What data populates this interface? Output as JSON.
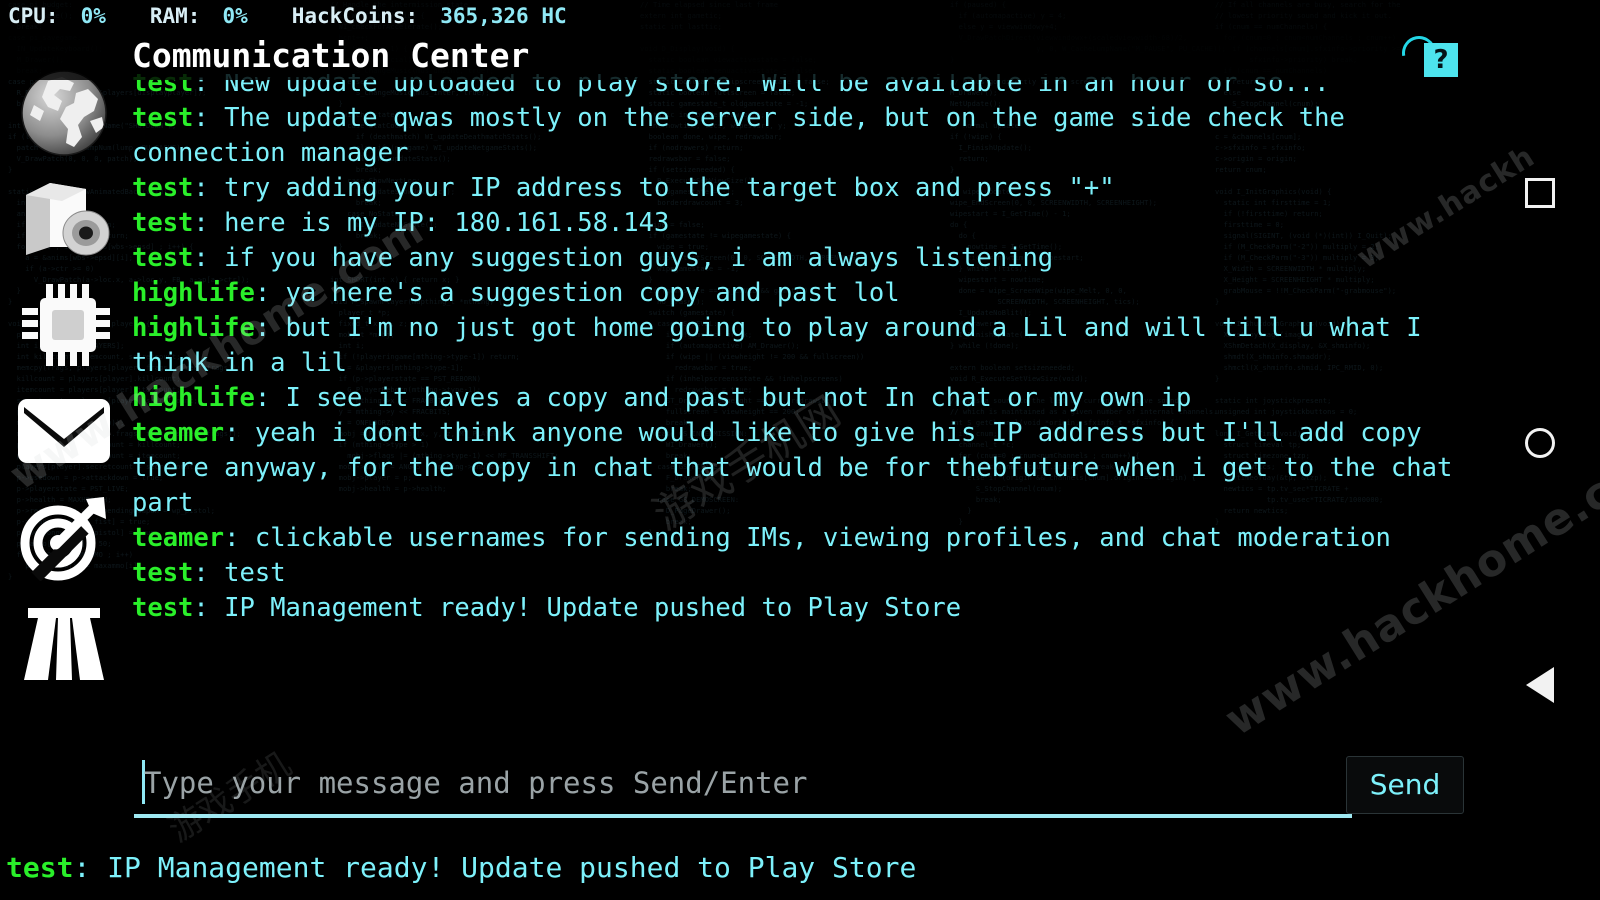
{
  "hud": {
    "cpu_label": "CPU:",
    "cpu_value": "0%",
    "ram_label": "RAM:",
    "ram_value": "0%",
    "coins_label": "HackCoins:",
    "coins_value": "365,326 HC"
  },
  "header": {
    "title": "Communication Center",
    "help_label": "?"
  },
  "sidebar": {
    "items": [
      {
        "name": "globe-icon",
        "label": "World"
      },
      {
        "name": "software-icon",
        "label": "Software"
      },
      {
        "name": "cpu-icon",
        "label": "Hardware"
      },
      {
        "name": "mail-icon",
        "label": "Messages"
      },
      {
        "name": "target-icon",
        "label": "Targets"
      },
      {
        "name": "road-icon",
        "label": "Missions"
      }
    ]
  },
  "chat": {
    "messages": [
      {
        "user": "test",
        "text": "New update uploaded to play store. Will be available in an hour or so..."
      },
      {
        "user": "test",
        "text": "The update qwas mostly on the server side, but on the game side check the connection manager"
      },
      {
        "user": "test",
        "text": "try adding your IP address to the target box and press \"+\""
      },
      {
        "user": "test",
        "text": "here is my IP: 180.161.58.143"
      },
      {
        "user": "test",
        "text": "if you have any suggestion guys, i am always listening"
      },
      {
        "user": "highlife",
        "text": "ya here's a suggestion copy and past lol"
      },
      {
        "user": "highlife",
        "text": "but I'm no just got home going to play around a Lil and will till u what I think in a lil"
      },
      {
        "user": "highlife",
        "text": "I see it haves a copy and past but not In chat or my own ip"
      },
      {
        "user": "teamer",
        "text": "yeah i dont think anyone would like to give his IP address but I'll add copy there anyway, for the copy in chat that would be for thebfuture when i get to the chat part"
      },
      {
        "user": "teamer",
        "text": "clickable usernames for sending IMs, viewing profiles, and chat moderation"
      },
      {
        "user": "test",
        "text": "test"
      },
      {
        "user": "test",
        "text": "IP Management ready! Update pushed to Play Store"
      }
    ]
  },
  "composer": {
    "input_value": "",
    "placeholder": "Type your message and press Send/Enter",
    "send_label": "Send"
  },
  "ticker": {
    "user": "test",
    "separator": ": ",
    "text": "IP Management ready! Update pushed to Play Store"
  },
  "navbar": {
    "recents_label": "recents-square-icon",
    "home_label": "home-circle-icon",
    "back_label": "back-triangle-icon"
  },
  "watermarks": {
    "site": "www.hackhome.com",
    "site_short": "www.hackh",
    "cn": "游戏手机网",
    "cn2": "游戏手机"
  },
  "colors": {
    "accent_cyan": "#7df1fb",
    "username_green": "#2aef2a",
    "help_badge": "#4de4ee",
    "background": "#000000"
  },
  "code_texture": {
    "col1": "case pi_budget:\n  D_DrawGame();\n  break;\ncase pi_savegame:\n  IN_UpdateKeyboard();\n  M_Drawer();\n  break;\ncase pi_loadgame:\n  R_RenderPlayerView(&players[displayplayer]);\n  break;\n\nint lump = W_GetNumForName(\"SHUTDOWN\");\nif (lump != -1) {\n  patch = W_CacheLumpNum(lump, PU_CACHE);\n  V_DrawPatch(0, 0, 0, patch);\n}\n\nstatic void WI_drawAnimatedBack(void) {\n  int i;\n  anim_t *a;\n  if (commercial) return;\n  if (wbs->epsd > 2) return;\n  for (i=0 ; i<NUMANIMS[wbs->epsd] ; i++) {\n    a = &anims[wbs->epsd][i];\n    if (a->ctr >= 0)\n      V_DrawPatch(a->loc.x, a->loc.y, FB, a->p[a->ctr]);\n  }\n}\n\nvoid G_PlayerReborn(int player) {\n  player_t *p;\n  int i, frags[MAXPLAYERS];\n  int killcount, itemcount, secretcount;\n  memcpy(frags, players[player].frags, sizeof(frags));\n  killcount = players[player].killcount;\n  itemcount = players[player].itemcount;\n  secretcount = players[player].secretcount;\n  p = &players[player];\n  memset(p, 0, sizeof(*p));\n  memcpy(players[player].frags, frags, sizeof(frags));\n  players[player].killcount = killcount;\n  players[player].itemcount = itemcount;\n  players[player].secretcount = secretcount;\n  p->usedown = p->attackdown = true;\n  p->playerstate = PST_LIVE;\n  p->health = MAXHEALTH;\n  p->readyweapon = p->pendingweapon = wp_pistol;\n  p->weaponowned[wp_fist] = true;\n  p->weaponowned[wp_pistol] = true;\n  p->ammo[am_clip] = 50;\n  for (i=0 ; i<NUMAMMO ; i++)\n    p->maxammo[i] = maxammo[i];\n}",
    "col2": "// Handle the intermission state\nvoid WI_Ticker(void) {\n  WI_checkForAccelerate();\n  bcnt++;\n  if (bcnt == 1) {\n    if (commercial)\n      S_ChangeMusic(mus_dm2int, true);\n    else\n      S_ChangeMusic(mus_inter, true);\n  }\n  switch (state) {\n    case StatCount:\n      if (deathmatch) WI_updateDeathmatchStats();\n      else if (netgame) WI_updateNetgameStats();\n      else WI_updateStats();\n      break;\n    case ShowNextLoc:\n      WI_updateShowNextLoc();\n      break;\n    case NoState:\n      WI_updateNoState();\n      break;\n  }\n}\n\nint SHORT(int x) { return x; }\n\nvoid P_SpawnPlayer(mapthing_t *mthing) {\n  player_t *p;\n  fixed_t x, y, z;\n  mobj_t *mobj;\n  int i;\n  if (!playeringame[mthing->type-1]) return;\n  p = &players[mthing->type-1];\n  if (p->playerstate == PST_REBORN)\n    G_PlayerReborn(mthing->type-1);\n  x = mthing->x << FRACBITS;\n  y = mthing->y << FRACBITS;\n  z = ONFLOORZ;\n  mobj = P_SpawnMobj(x, y, z, MT_PLAYER);\n  if (mthing->type > 1)\n    mobj->flags |= (mthing->type-1) << MF_TRANSSHIFT;\n  mobj->angle = ANG45 * (mthing->angle/45);\n  mobj->player = p;\n  mobj->health = p->health;",
    "col3": "// Time elapsed since last frame\nextern int gametic;\nstatic int lasttic;\n\nvoid D_Display(void) {\n  static boolean viewactivestate = false;\n  static boolean menuactivestate = false;\n  static boolean inhelpscreensstate = false;\n  static boolean fullscreen = false;\n  static gamestate_t oldgamestate = -1;\n  static int borderdrawcount;\n  int nowtime, tics, wipestart, y;\n  boolean done, wipe, redrawsbar;\n  if (nodrawers) return;\n  redrawsbar = false;\n  if (setsizeneeded) {\n    R_ExecuteSetViewSize();\n    oldgamestate = -1;\n    borderdrawcount = 3;\n  }\n  wipe = false;\n  if (gamestate != wipegamestate) {\n    wipe = true;\n    wipe_StartScreen(0, 0, SCREENWIDTH, SCREENHEIGHT);\n    wipegamestate = -1;\n  }\n  if (gamestate == GS_LEVEL && gametic)\n    HU_Erase();\n  switch (gamestate) {\n    case GS_LEVEL:\n      if (!gametic) break;\n      if (automapactive) AM_Drawer();\n      if (wipe || (viewheight != 200 && fullscreen))\n        redrawsbar = true;\n      if (inhelpscreensstate && !inhelpscreens)\n        redrawsbar = true;\n      ST_Drawer(viewheight == 200, redrawsbar);\n      fullscreen = viewheight == 200;\n      break;\n    case GS_INTERMISSION:\n      WI_Drawer();\n      break;\n    case GS_FINALE:\n      F_Drawer();\n      break;\n    case GS_DEMOSCREEN:\n      D_PageDrawer();\n      break;\n  }",
    "col4": "if (paused) {\n  if (automapactive) y = 4;\n  else y = viewwindowy+4;\n  V_DrawPatchDirect(viewwindowx+(scaledviewwidth-68)/2,\n                    y, 0, W_CacheLumpName(\"M_PAUSE\", PU_CACHE));\n}\n\n// menus go directly to the screen\nM_Drawer();\nNetUpdate();\n\n// normal update\nif (!wipe) {\n  I_FinishUpdate();\n  return;\n}\n\n// wipe update\nwipe_EndScreen(0, 0, SCREENWIDTH, SCREENHEIGHT);\nwipestart = I_GetTime() - 1;\ndo {\n  do {\n    nowtime = I_GetTime();\n    tics = nowtime - wipestart;\n  } while (!tics);\n  wipestart = nowtime;\n  done = wipe_ScreenWipe(wipe_Melt, 0, 0,\n           SCREENWIDTH, SCREENHEIGHT, tics);\n  I_UpdateNoBlit();\n  M_Drawer();\n  I_FinishUpdate();\n} while (!done);\n\nextern boolean setsizeneeded;\nvoid R_ExecuteSetViewSize(void);\n\n// Adds a sound to the list of currently active sounds,\n// which is maintained as a given number of internal channels.\nint S_getChannel(void *origin, sfxinfo_t *sfxinfo) {\n  int cnum;\n  channel_t *c;\n  for (cnum=0 ; cnum<numChannels ; cnum++) {\n    if (!channels[cnum].sfxinfo) break;\n    else if (origin && channels[cnum].origin == origin) {\n      S_StopChannel(cnum);\n      break;\n    }\n  }",
    "col5": "// If all channels are busy, search for the\n// lowest priority sound and kick it out.\nif (cnum == numChannels) {\n  for (cnum=0 ; cnum<numChannels ; cnum++)\n    if (channels[cnum].sfxinfo->priority >=\n        sfxinfo->priority) break;\n  if (cnum == numChannels)\n    return -1;\n  else\n    S_StopChannel(cnum);\n}\n\nc = &channels[cnum];\nc->sfxinfo = sfxinfo;\nc->origin = origin;\nreturn cnum;\n\nvoid I_InitGraphics(void) {\n  static int firsttime = 1;\n  if (!firsttime) return;\n  firsttime = 0;\n  signal(SIGINT, (void (*)(int)) I_Quit);\n  if (M_CheckParm(\"-2\")) multiply = 2;\n  if (M_CheckParm(\"-3\")) multiply = 3;\n  X_Width = SCREENWIDTH * multiply;\n  X_Height = SCREENHEIGHT * multiply;\n  grabMouse = !!M_CheckParm(\"-grabmouse\");\n}\n\nvoid I_ShutdownGraphics(void) {\n  XDestroyImage(image);\n  XShmDetach(X_display, &X_shminfo);\n  shmdt(X_shminfo.shmaddr);\n  shmctl(X_shminfo.shmid, IPC_RMID, 0);\n}\n\nstatic int joystickpresent;\nunsigned int joystickbuttons = 0;\n\nlong I_GetTime(void) {\n  struct timeval tp;\n  struct timezone tzp;\n  int newtics;\n  gettimeofday(&tp, &tzp);\n  newtics = tp.tv_sec*TICRATE +\n            tp.tv_usec*TICRATE/1000000;\n  return newtics;\n}"
  }
}
